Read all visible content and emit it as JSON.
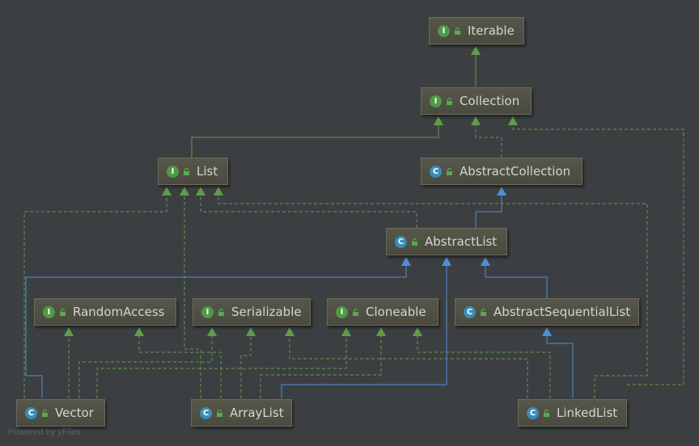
{
  "nodes": {
    "iterable": {
      "label": "Iterable",
      "kind": "I"
    },
    "collection": {
      "label": "Collection",
      "kind": "I"
    },
    "list": {
      "label": "List",
      "kind": "I"
    },
    "abstract_collection": {
      "label": "AbstractCollection",
      "kind": "C"
    },
    "abstract_list": {
      "label": "AbstractList",
      "kind": "C"
    },
    "random_access": {
      "label": "RandomAccess",
      "kind": "I"
    },
    "serializable": {
      "label": "Serializable",
      "kind": "I"
    },
    "cloneable": {
      "label": "Cloneable",
      "kind": "I"
    },
    "abstract_sequential_list": {
      "label": "AbstractSequentialList",
      "kind": "C"
    },
    "vector": {
      "label": "Vector",
      "kind": "C"
    },
    "array_list": {
      "label": "ArrayList",
      "kind": "C"
    },
    "linked_list": {
      "label": "LinkedList",
      "kind": "C"
    }
  },
  "edge_colors": {
    "implements": "#5f9d4a",
    "extends": "#4f8fd6"
  },
  "watermark": "Powered by yFiles"
}
